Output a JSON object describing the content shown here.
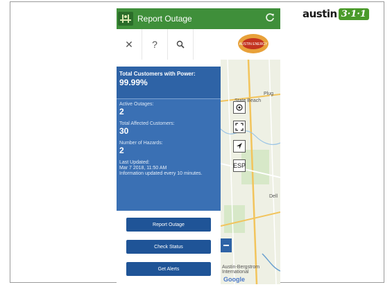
{
  "brand": {
    "word": "austin",
    "badge": "3·1·1"
  },
  "app": {
    "title": "Report Outage",
    "logo_icon": "lineman-icon",
    "refresh_icon": "refresh-icon"
  },
  "toolbar": {
    "close": "✕",
    "help": "?",
    "search_icon": "search-icon",
    "logo_text": "AUSTIN ENERGY"
  },
  "status": {
    "power_label": "Total Customers with Power:",
    "power_value": "99.99%",
    "active_label": "Active Outages:",
    "active_value": "2",
    "affected_label": "Total Affected Customers:",
    "affected_value": "30",
    "hazards_label": "Number of Hazards:",
    "hazards_value": "2",
    "updated_label": "Last Updated:",
    "updated_value": "Mar 7 2018, 11:50 AM",
    "updated_note": "Information updated every 10 minutes."
  },
  "actions": {
    "report": "Report Outage",
    "check": "Check Status",
    "alerts": "Get Alerts"
  },
  "map": {
    "labels": {
      "plug": "Plug",
      "state_beach": "State Beach",
      "dell": "Dell",
      "airport": "Austin-Bergstrom International",
      "google": "Google"
    },
    "controls": {
      "esp": "ESP"
    }
  },
  "colors": {
    "appbar": "#3f8f3a",
    "panel": "#3a70b4",
    "button": "#1f5497"
  }
}
